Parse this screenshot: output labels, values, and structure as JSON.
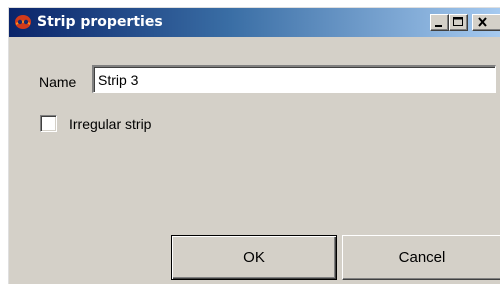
{
  "window": {
    "title": "Strip properties",
    "minimize_glyph": "_",
    "icon": "app-logo-icon"
  },
  "form": {
    "name_label": "Name",
    "name_value": "Strip 3",
    "irregular_label": "Irregular strip",
    "irregular_checked": false
  },
  "buttons": {
    "ok_label": "OK",
    "cancel_label": "Cancel"
  },
  "colors": {
    "titlebar_start": "#0a246a",
    "titlebar_end": "#a6caf0",
    "face": "#d4d0c8"
  }
}
